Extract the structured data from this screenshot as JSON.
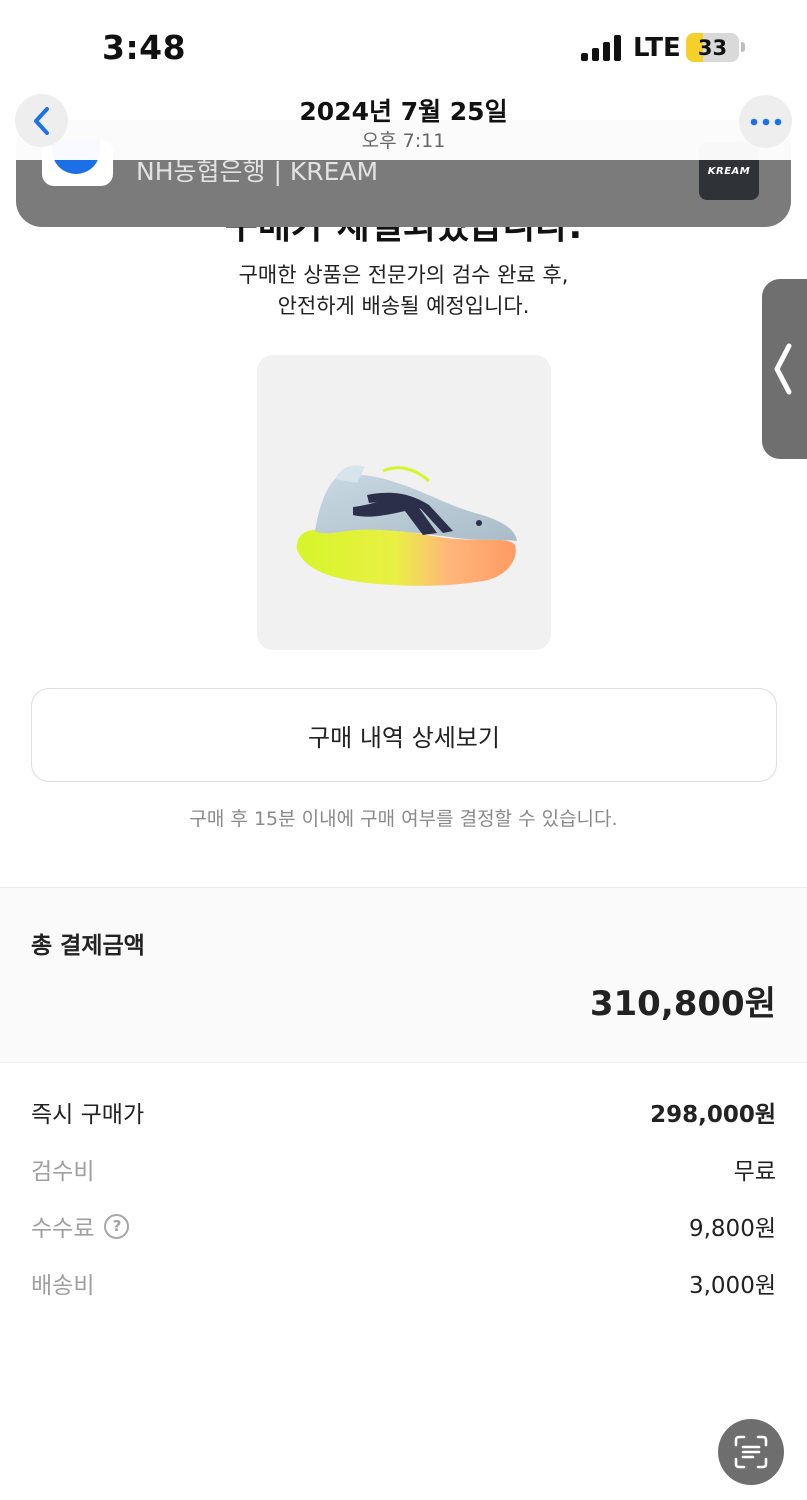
{
  "status_bar": {
    "time": "3:48",
    "network": "LTE",
    "battery_level": "33",
    "battery_fraction": 0.33,
    "battery_color": "#f5d02a"
  },
  "nav": {
    "date": "2024년 7월 25일",
    "time": "오후 7:11",
    "back_icon": "chevron-left-icon",
    "more_icon": "ellipsis-icon",
    "accent": "#1a73e8"
  },
  "notification": {
    "title": "NH농협은행 | KREAM",
    "thumb_text": "KREAM"
  },
  "message": {
    "heading_partial": "구매가 체결되었습니다.",
    "subtitle_line1": "구매한 상품은 전문가의 검수 완료 후,",
    "subtitle_line2": "안전하게 배송될 예정입니다."
  },
  "product": {
    "image_icon": "sneaker-image"
  },
  "detail_button": {
    "label": "구매 내역 상세보기"
  },
  "notice": "구매 후 15분 이내에 구매 여부를 결정할 수 있습니다.",
  "total": {
    "label": "총 결제금액",
    "amount": "310,800원"
  },
  "fees": [
    {
      "label": "즉시 구매가",
      "value": "298,000원"
    },
    {
      "label": "검수비",
      "value": "무료"
    },
    {
      "label": "수수료",
      "value": "9,800원",
      "help": "?"
    },
    {
      "label": "배송비",
      "value": "3,000원"
    }
  ]
}
